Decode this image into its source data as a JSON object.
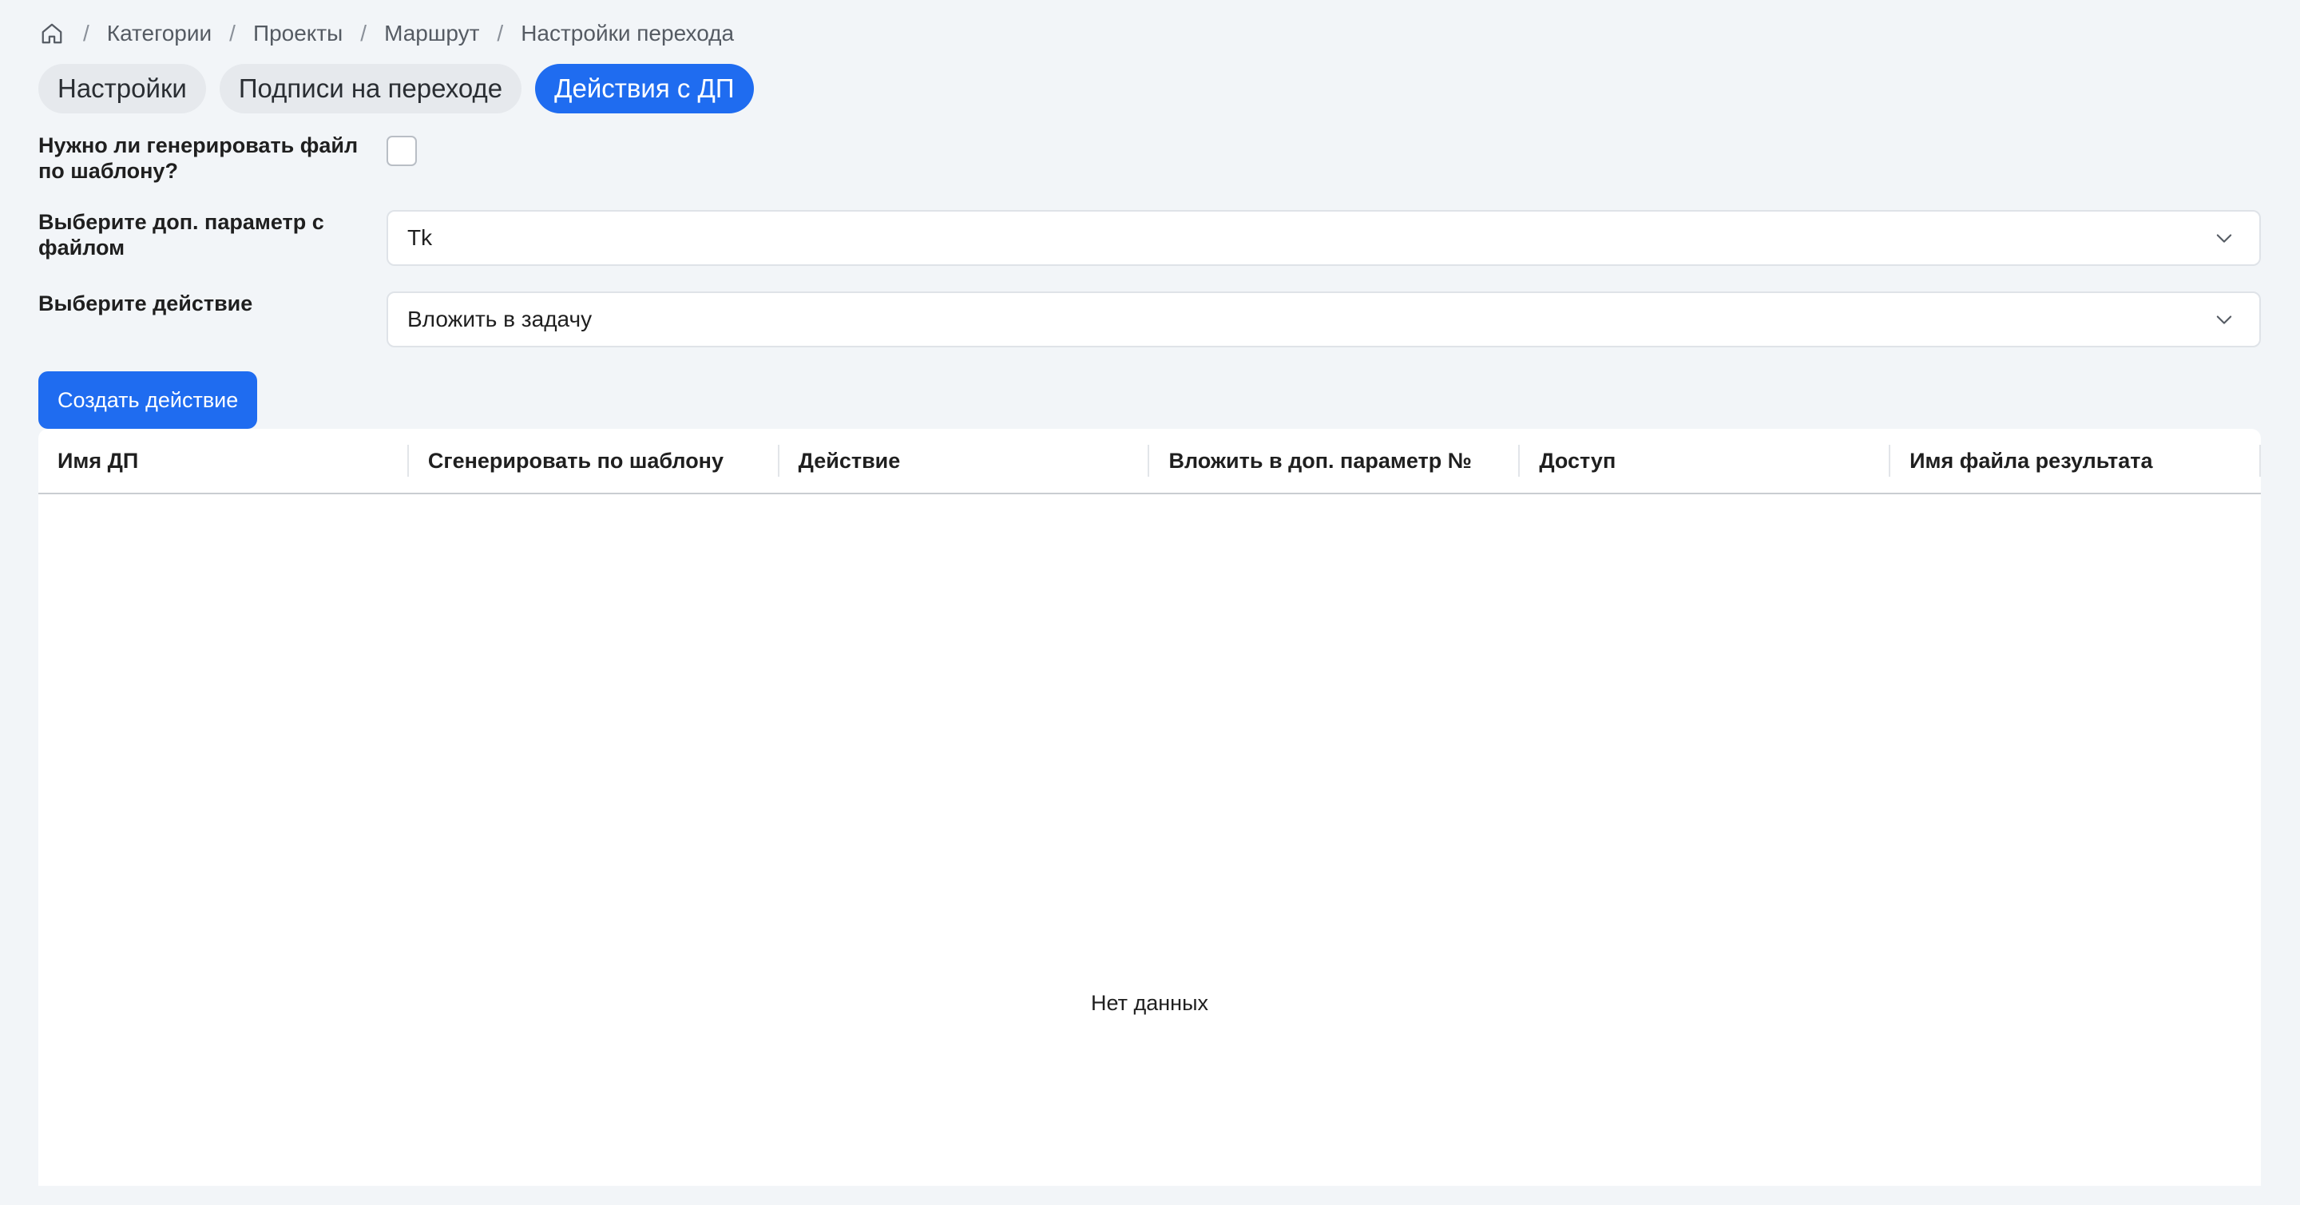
{
  "breadcrumb": {
    "home_icon": "home-icon",
    "items": [
      "Категории",
      "Проекты",
      "Маршрут",
      "Настройки перехода"
    ]
  },
  "tabs": [
    {
      "label": "Настройки",
      "active": false
    },
    {
      "label": "Подписи на переходе",
      "active": false
    },
    {
      "label": "Действия с ДП",
      "active": true
    }
  ],
  "form": {
    "generate_label": "Нужно ли генерировать файл по шаблону?",
    "generate_checked": false,
    "param_label": "Выберите доп. параметр с файлом",
    "param_value": "Tk",
    "action_label": "Выберите действие",
    "action_value": "Вложить в задачу"
  },
  "create_button": "Создать действие",
  "table": {
    "columns": [
      "Имя ДП",
      "Сгенерировать по шаблону",
      "Действие",
      "Вложить в доп. параметр №",
      "Доступ",
      "Имя файла результата"
    ],
    "empty_text": "Нет данных"
  },
  "colors": {
    "accent": "#1f6cf0",
    "background": "#f2f5f8"
  }
}
